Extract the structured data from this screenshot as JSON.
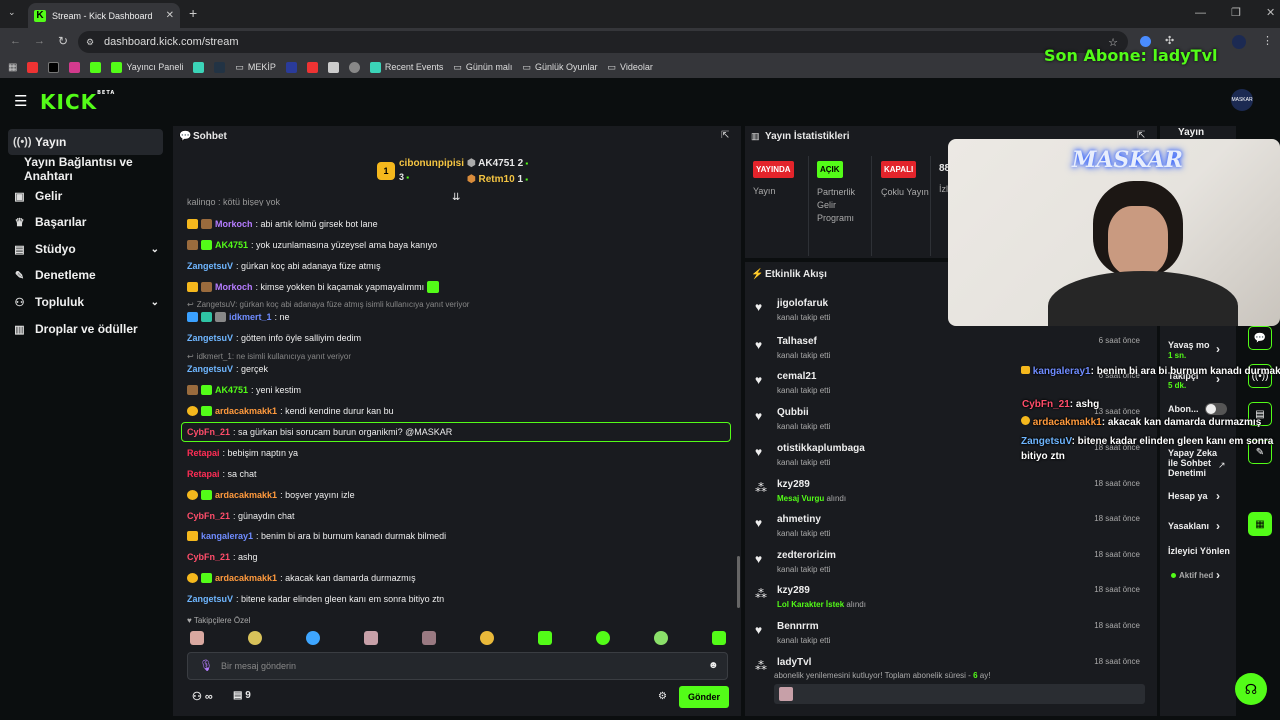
{
  "browser": {
    "tab_title": "Stream - Kick Dashboard",
    "url": "dashboard.kick.com/stream",
    "bookmarks": [
      "Yayıncı Paneli",
      "MEKİP",
      "Recent Events",
      "Günün malı",
      "Günlük Oyunlar",
      "Videolar"
    ]
  },
  "overlay": {
    "last_sub": "Son Abone: ladyTvl",
    "webcam_label": "MASKAR"
  },
  "kick": {
    "logo": "KICK",
    "logo_sup": "BETA",
    "avatar": "MASKAR"
  },
  "sidebar": {
    "items": [
      {
        "label": "Yayın",
        "icon": "broadcast-icon"
      },
      {
        "label": "Yayın Bağlantısı ve Anahtarı",
        "icon": ""
      },
      {
        "label": "Gelir",
        "icon": "wallet-icon"
      },
      {
        "label": "Başarılar",
        "icon": "trophy-icon"
      },
      {
        "label": "Stüdyo",
        "icon": "studio-icon"
      },
      {
        "label": "Denetleme",
        "icon": "wrench-icon"
      },
      {
        "label": "Topluluk",
        "icon": "people-icon"
      },
      {
        "label": "Droplar ve ödüller",
        "icon": "gift-icon"
      }
    ]
  },
  "chat": {
    "title": "Sohbet",
    "top_gifters": [
      {
        "name": "cibonunpipisi",
        "count": "3"
      },
      {
        "name": "AK4751",
        "count": "2"
      },
      {
        "name": "Retm10",
        "count": "1"
      }
    ],
    "partial_top": "kalingo : kötü bişey yok",
    "messages": [
      {
        "user": "Morkoch",
        "color": "#b57cff",
        "text": ": abi artık lolmü girsek bot lane"
      },
      {
        "user": "AK4751",
        "color": "#53fc18",
        "text": ": yok uzunlamasına yüzeysel ama baya kanıyo"
      },
      {
        "user": "ZangetsuV",
        "color": "#6fb6ff",
        "text": ": gürkan koç abi adanaya füze atmış"
      },
      {
        "user": "Morkoch",
        "color": "#b57cff",
        "text": ": kimse yokken bi kaçamak yapmayalımmı"
      },
      {
        "reply": "ZangetsuV: gürkan koç abi adanaya füze atmış isimli kullanıcıya yanıt veriyor"
      },
      {
        "user": "idkmert_1",
        "color": "#6f8cff",
        "text": ": ne"
      },
      {
        "user": "ZangetsuV",
        "color": "#6fb6ff",
        "text": ": götten info öyle salliyim dedim"
      },
      {
        "reply": "idkmert_1: ne isimli kullanıcıya yanıt veriyor"
      },
      {
        "user": "ZangetsuV",
        "color": "#6fb6ff",
        "text": ": gerçek"
      },
      {
        "user": "AK4751",
        "color": "#53fc18",
        "text": ": yeni kestim"
      },
      {
        "user": "ardacakmakk1",
        "color": "#ff9a3d",
        "text": ": kendi kendine durur kan bu"
      },
      {
        "user": "CybFn_21",
        "color": "#ff4d6a",
        "text": ": sa gürkan bisi sorucam burun organikmi? @MASKAR"
      },
      {
        "user": "Retapai",
        "color": "#ff2d55",
        "text": ": bebişim naptın ya"
      },
      {
        "user": "Retapai",
        "color": "#ff2d55",
        "text": ": sa chat"
      },
      {
        "user": "ardacakmakk1",
        "color": "#ff9a3d",
        "text": ": boşver yayını izle"
      },
      {
        "user": "CybFn_21",
        "color": "#ff4d6a",
        "text": ": günaydın chat"
      },
      {
        "user": "kangaleray1",
        "color": "#6f8cff",
        "text": ": benim bi ara bi burnum kanadı durmak bilmedi"
      },
      {
        "user": "CybFn_21",
        "color": "#ff4d6a",
        "text": ": ashg"
      },
      {
        "user": "ardacakmakk1",
        "color": "#ff9a3d",
        "text": ": akacak kan damarda durmazmış"
      },
      {
        "user": "ZangetsuV",
        "color": "#6fb6ff",
        "text": ": bitene kadar elinden gleen kanı em sonra bitiyo ztn"
      }
    ],
    "followers_only": "Takipçilere Özel",
    "input_placeholder": "Bir mesaj gönderin",
    "infinite": "∞",
    "store_count": "9",
    "send_label": "Gönder"
  },
  "stats": {
    "title": "Yayın İstatistikleri",
    "cards": [
      {
        "status": "YAYINDA",
        "color": "#e3242b",
        "label": "Yayın"
      },
      {
        "status": "AÇIK",
        "color": "#53fc18",
        "label": "Partnerlik Gelir Programı"
      },
      {
        "status": "KAPALI",
        "color": "#e3242b",
        "label": "Çoklu Yayın"
      }
    ],
    "partial": "88",
    "partial_label": "İzl"
  },
  "activity": {
    "title": "Etkinlik Akışı",
    "items": [
      {
        "name": "jigolofaruk",
        "sub": "kanalı takip etti",
        "highlight": "",
        "after": "",
        "time": ""
      },
      {
        "name": "Talhasef",
        "sub": "kanalı takip etti",
        "highlight": "",
        "after": "",
        "time": "6 saat önce"
      },
      {
        "name": "cemal21",
        "sub": "kanalı takip etti",
        "highlight": "",
        "after": "",
        "time": "6 saat önce"
      },
      {
        "name": "Qubbii",
        "sub": "kanalı takip etti",
        "highlight": "",
        "after": "",
        "time": "13 saat önce"
      },
      {
        "name": "otistikkaplumbaga",
        "sub": "kanalı takip etti",
        "highlight": "",
        "after": "",
        "time": "18 saat önce"
      },
      {
        "name": "kzy289",
        "sub": "",
        "highlight": "Mesaj Vurgu",
        "after": " alındı",
        "time": "18 saat önce"
      },
      {
        "name": "ahmetiny",
        "sub": "kanalı takip etti",
        "highlight": "",
        "after": "",
        "time": "18 saat önce"
      },
      {
        "name": "zedterorizim",
        "sub": "kanalı takip etti",
        "highlight": "",
        "after": "",
        "time": "18 saat önce"
      },
      {
        "name": "kzy289",
        "sub": "",
        "highlight": "Lol Karakter İstek",
        "after": " alındı",
        "time": "18 saat önce"
      },
      {
        "name": "Bennrrm",
        "sub": "kanalı takip etti",
        "highlight": "",
        "after": "",
        "time": "18 saat önce"
      }
    ],
    "last": {
      "name": "ladyTvl",
      "sub": "abonelik yenilemesini kutluyor! Toplam abonelik süresi - ",
      "months": "6",
      "suffix": " ay!",
      "time": "18 saat önce"
    }
  },
  "right_column": {
    "items": [
      "Yayın",
      "Yavaş mo",
      "1 sn.",
      "Takipçi",
      "5 dk.",
      "Abon...",
      "Yapay Zeka ile Sohbet Denetimi",
      "Hesap ya",
      "Yasaklanı",
      "İzleyici Yönlen",
      "Aktif hed"
    ]
  },
  "overlay_chat": [
    {
      "user": "kangaleray1",
      "color": "#6f8cff",
      "text": ": benim bi ara bi burnum kanadı durmak bilmedi"
    },
    {
      "user": "CybFn_21",
      "color": "#ff4d6a",
      "text": ": ashg"
    },
    {
      "user": "ardacakmakk1",
      "color": "#ff9a3d",
      "text": ": akacak kan damarda durmazmış"
    },
    {
      "user": "ZangetsuV",
      "color": "#6fb6ff",
      "text": ": bitene kadar elinden gleen kanı em sonra bitiyo ztn"
    }
  ]
}
